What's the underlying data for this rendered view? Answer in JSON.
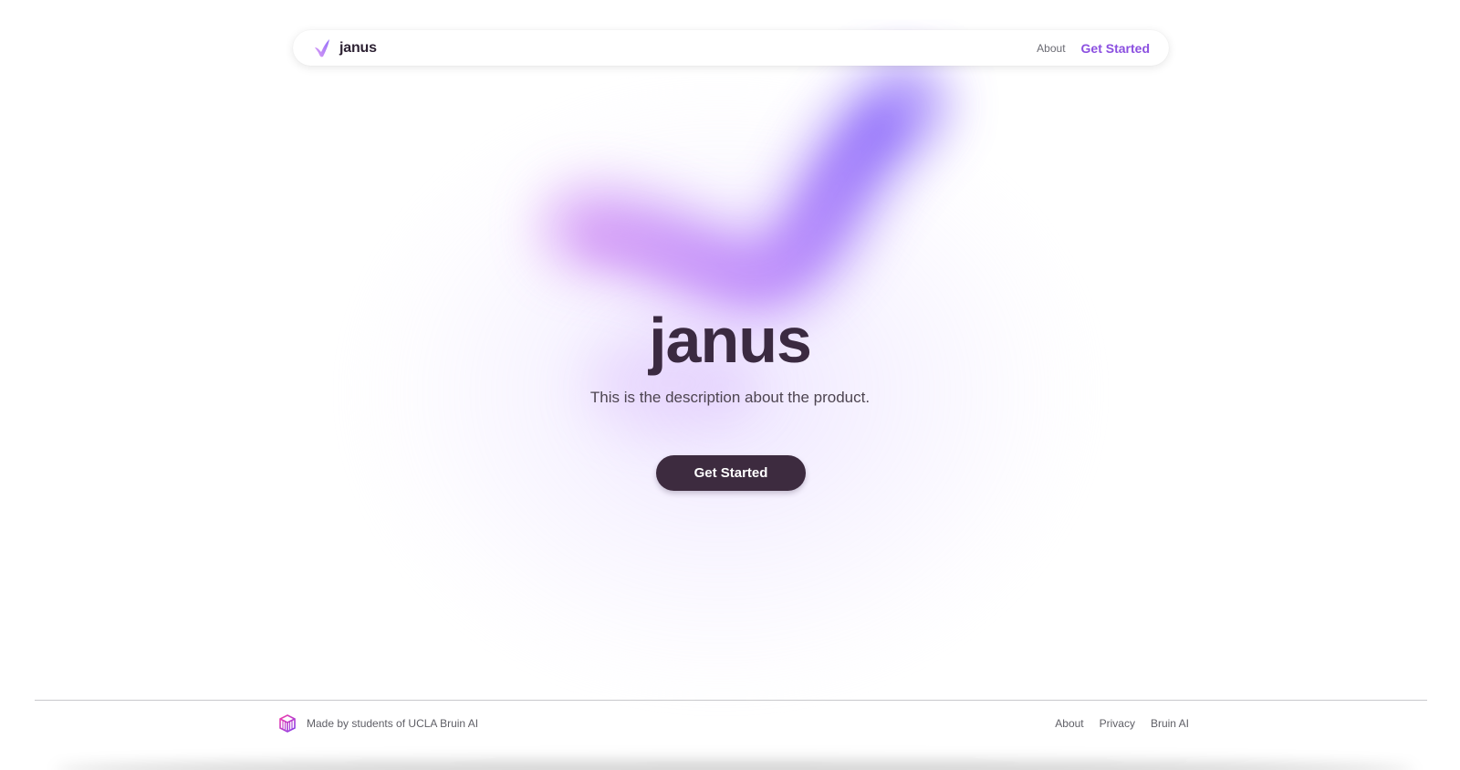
{
  "nav": {
    "brand": "janus",
    "links": [
      {
        "label": "About"
      }
    ],
    "cta_label": "Get Started"
  },
  "hero": {
    "title": "janus",
    "description": "This is the description about the product.",
    "cta_label": "Get Started"
  },
  "footer": {
    "credit": "Made by students of UCLA Bruin AI",
    "links": [
      {
        "label": "About"
      },
      {
        "label": "Privacy"
      },
      {
        "label": "Bruin AI"
      }
    ]
  },
  "colors": {
    "accent": "#8b4fe0",
    "title": "#3b2a41",
    "button_bg": "#3d2b3f",
    "glow_pink": "#d39bf7",
    "glow_violet": "#9a79fb"
  },
  "icons": {
    "brand": "checkmark-icon",
    "footer": "cube-logo-icon"
  }
}
